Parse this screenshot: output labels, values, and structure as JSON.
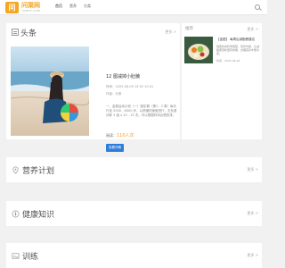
{
  "header": {
    "logo_icon": "问",
    "logo_name": "问渠网",
    "logo_sub": "TXMEX.COM",
    "nav": [
      "首页",
      "营养",
      "分类"
    ]
  },
  "headline_section": {
    "title": "头条",
    "more": "更多 >",
    "article": {
      "title": "12 图减掉小肚腩",
      "date_label": "时间：2025-06-09 13:02 10:41",
      "author_label": "作者：头条",
      "excerpt": "一、金属运动计划（一）固定期（第1 - 2 周）每天行走 5000 - 6000 步，以舒缓的速度进行，无负重训练 3 组 x 10 - 15 次。可以根据时间合理安排。",
      "views_label": "阅读：",
      "views_value": "110人次",
      "button": "查看详情"
    }
  },
  "recommend": {
    "title": "推荐",
    "more": "更多 >",
    "item": {
      "headline": "【金图】 每周后减脂餐建议",
      "desc": "健康饮食科学搭配，营养均衡，让减脂更轻松更有效果，合理营养才能享受。",
      "time": "时间：2025-06-25"
    }
  },
  "sections": [
    {
      "title": "营养计划",
      "more": "更多 >",
      "icon": "location-pin-icon"
    },
    {
      "title": "健康知识",
      "more": "更多 >",
      "icon": "compass-icon"
    },
    {
      "title": "训练",
      "more": "更多 >",
      "icon": "image-icon"
    }
  ]
}
